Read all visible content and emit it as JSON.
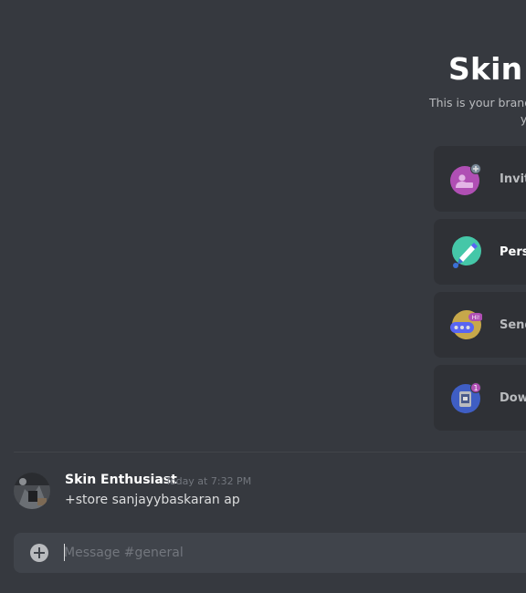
{
  "welcome": {
    "title": "Skin Enthusiast",
    "subtitle_line1": "This is your brand new, shiny server. Here are some steps to help",
    "subtitle_line2": "you get started."
  },
  "cards": [
    {
      "label": "Invite your friends",
      "icon": "invite-friends-icon"
    },
    {
      "label": "Personalize your server with an icon",
      "icon": "personalize-brush-icon"
    },
    {
      "label": "Send your first message",
      "icon": "send-message-icon"
    },
    {
      "label": "Download the Discord App",
      "icon": "download-app-icon"
    }
  ],
  "message": {
    "author": "Skin Enthusiast",
    "timestamp": "Today at 7:32 PM",
    "content": "+store sanjayybaskaran ap"
  },
  "composer": {
    "placeholder": "Message #general"
  },
  "colors": {
    "background": "#36393f",
    "card": "#2f3136",
    "input": "#40444b",
    "text_muted": "#72767d"
  }
}
